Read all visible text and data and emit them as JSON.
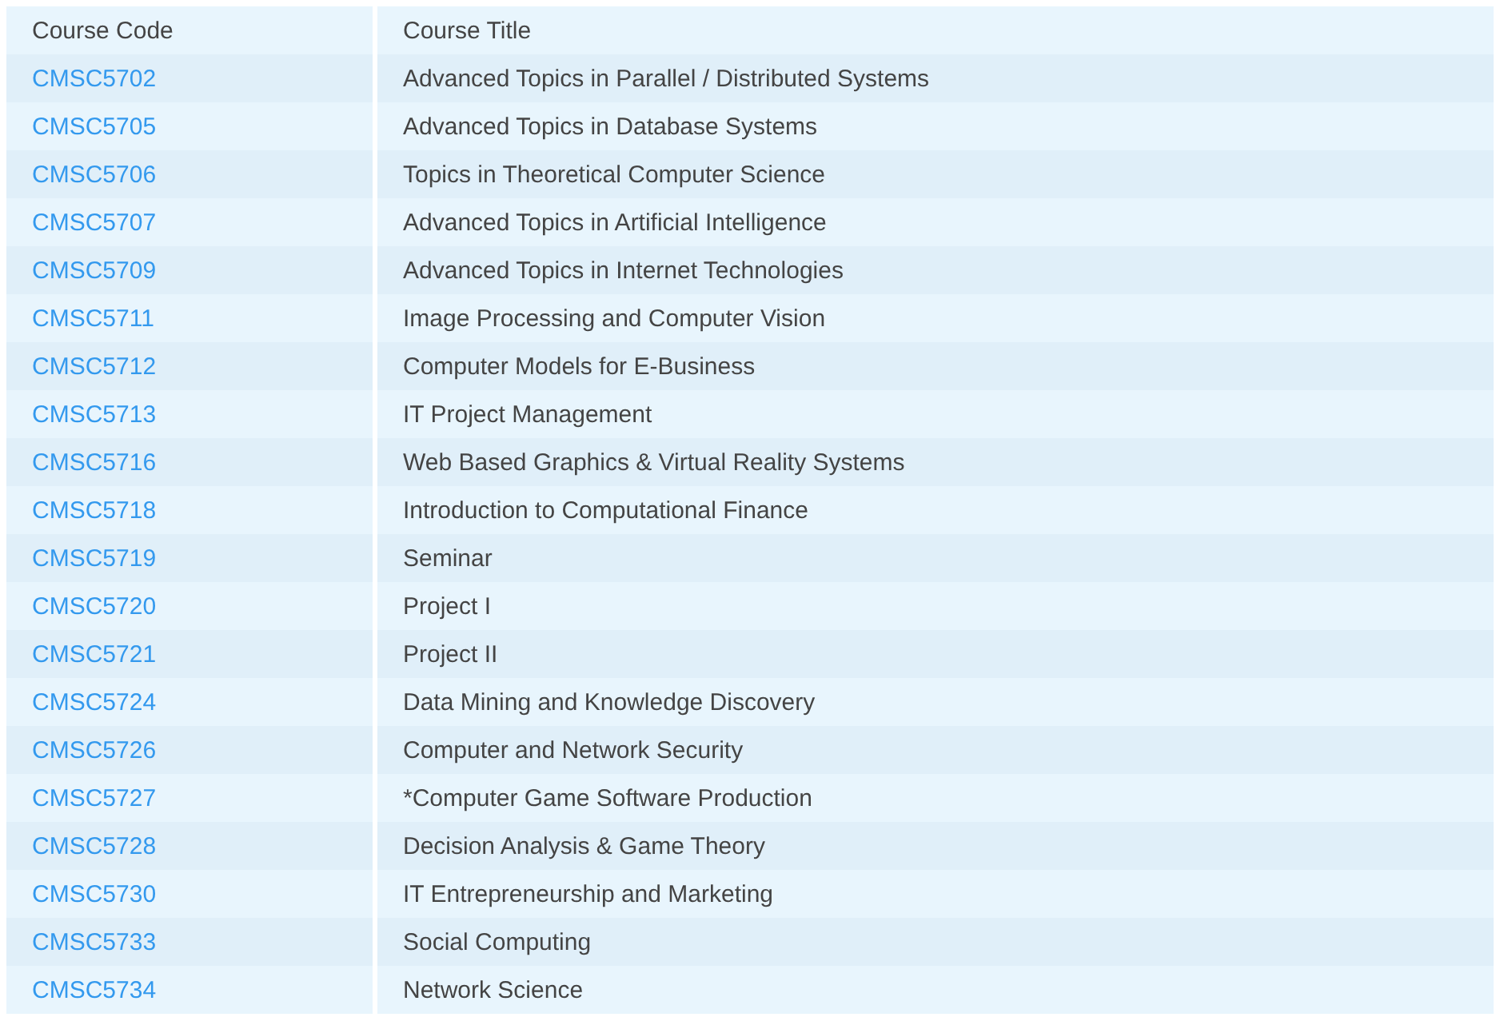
{
  "table": {
    "columns": [
      "Course Code",
      "Course Title"
    ],
    "rows": [
      {
        "code": "CMSC5702",
        "title": "Advanced Topics in Parallel / Distributed Systems"
      },
      {
        "code": "CMSC5705",
        "title": "Advanced Topics in Database Systems"
      },
      {
        "code": "CMSC5706",
        "title": "Topics in Theoretical Computer Science"
      },
      {
        "code": "CMSC5707",
        "title": "Advanced Topics in Artificial Intelligence"
      },
      {
        "code": "CMSC5709",
        "title": "Advanced Topics in Internet Technologies"
      },
      {
        "code": "CMSC5711",
        "title": "Image Processing and Computer Vision"
      },
      {
        "code": "CMSC5712",
        "title": "Computer Models for E-Business"
      },
      {
        "code": "CMSC5713",
        "title": "IT Project Management"
      },
      {
        "code": "CMSC5716",
        "title": "Web Based Graphics & Virtual Reality Systems"
      },
      {
        "code": "CMSC5718",
        "title": "Introduction to Computational Finance"
      },
      {
        "code": "CMSC5719",
        "title": "Seminar"
      },
      {
        "code": "CMSC5720",
        "title": "Project I"
      },
      {
        "code": "CMSC5721",
        "title": "Project II"
      },
      {
        "code": "CMSC5724",
        "title": "Data Mining and Knowledge Discovery"
      },
      {
        "code": "CMSC5726",
        "title": "Computer and Network Security"
      },
      {
        "code": "CMSC5727",
        "title": "*Computer Game Software Production"
      },
      {
        "code": "CMSC5728",
        "title": "Decision Analysis & Game Theory"
      },
      {
        "code": "CMSC5730",
        "title": "IT Entrepreneurship and Marketing"
      },
      {
        "code": "CMSC5733",
        "title": "Social Computing"
      },
      {
        "code": "CMSC5734",
        "title": "Network Science"
      }
    ]
  }
}
